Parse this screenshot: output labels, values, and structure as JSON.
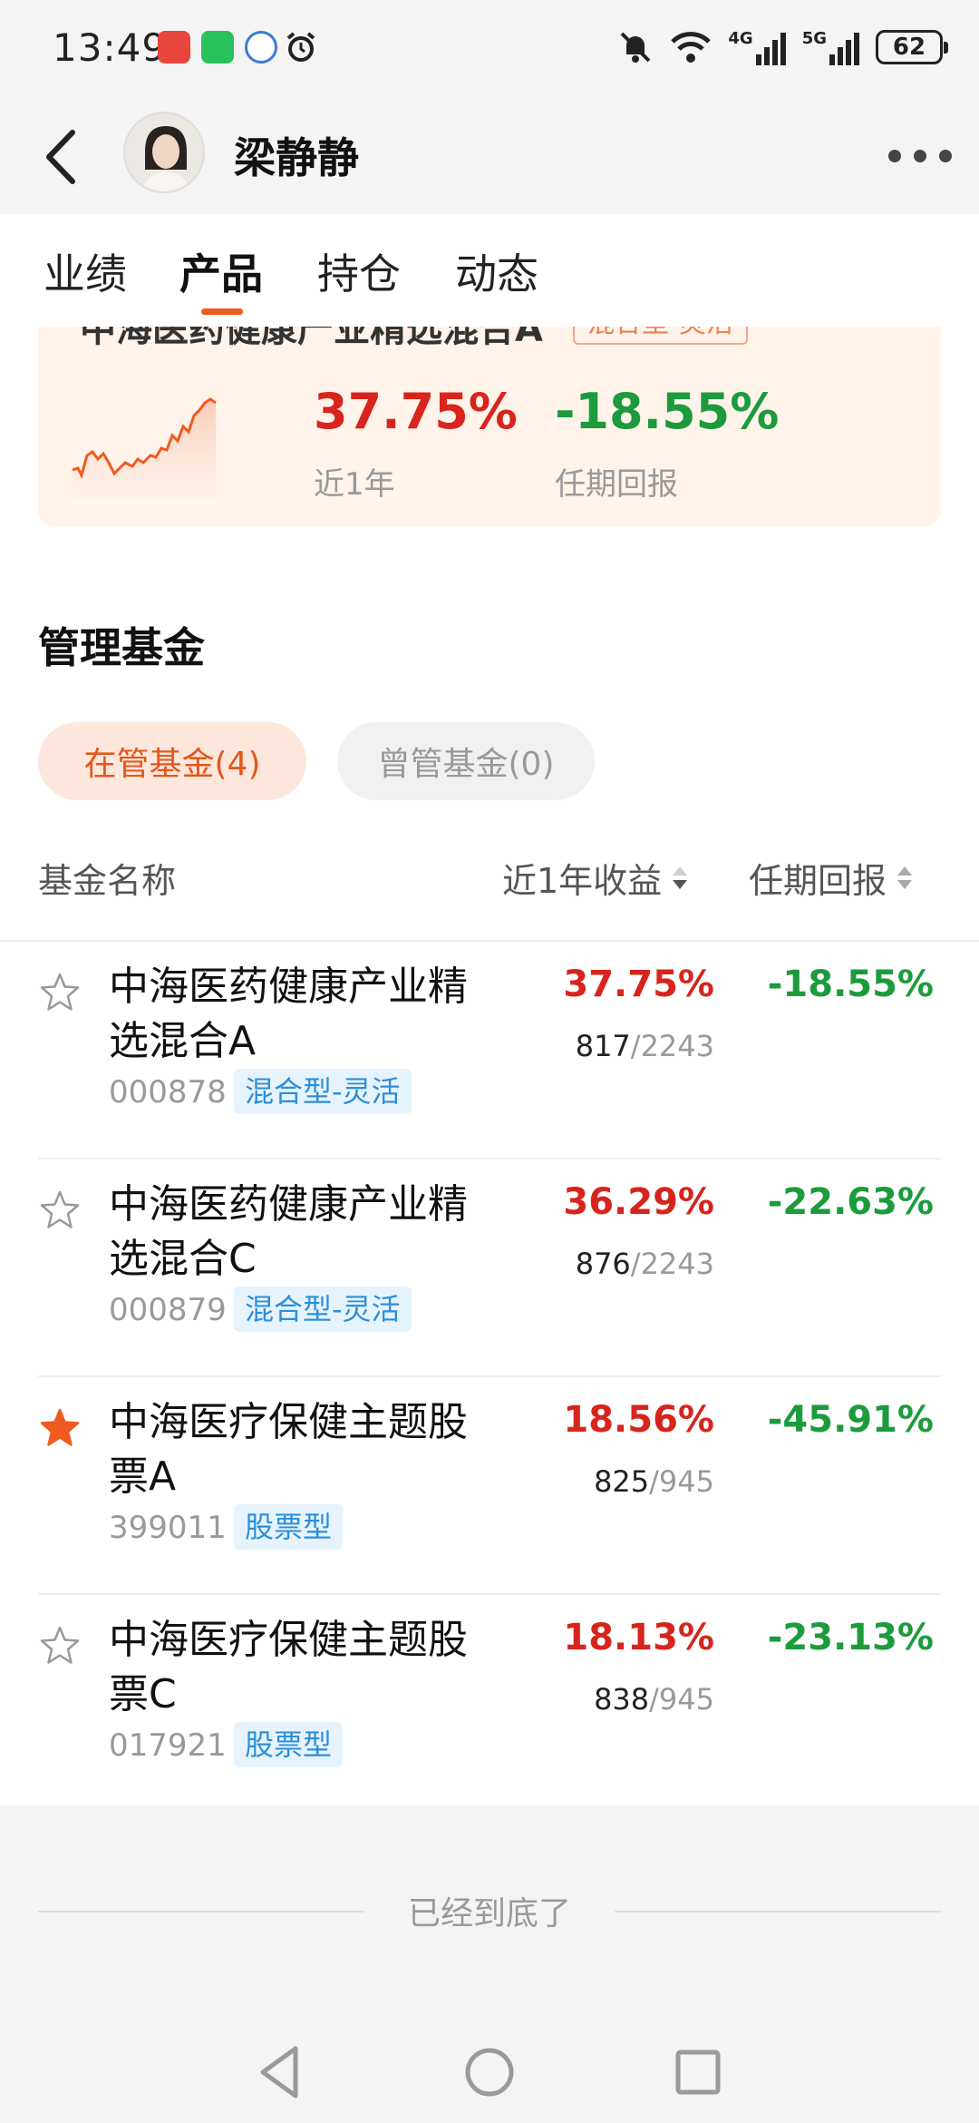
{
  "status_bar": {
    "time": "13:49",
    "battery": "62",
    "network_labels": [
      "4G",
      "5G"
    ]
  },
  "header": {
    "manager_name": "梁静静"
  },
  "tabs": [
    {
      "label": "业绩",
      "active": false
    },
    {
      "label": "产品",
      "active": true
    },
    {
      "label": "持仓",
      "active": false
    },
    {
      "label": "动态",
      "active": false
    }
  ],
  "top_card": {
    "fund_name": "中海医药健康产业精选混合A",
    "tag": "混合型-灵活",
    "ret_1y": "37.75%",
    "ret_1y_label": "近1年",
    "ret_tenure": "-18.55%",
    "ret_tenure_label": "任期回报"
  },
  "section": {
    "title": "管理基金",
    "pill_active": "在管基金(4)",
    "pill_inactive": "曾管基金(0)"
  },
  "columns": {
    "name": "基金名称",
    "ret_1y": "近1年收益",
    "ret_tenure": "任期回报"
  },
  "funds": [
    {
      "name": "中海医药健康产业精选混合A",
      "code": "000878",
      "type": "混合型-灵活",
      "ret_1y": "37.75%",
      "rank": "817",
      "total": "/2243",
      "ret_tenure": "-18.55%",
      "starred": false
    },
    {
      "name": "中海医药健康产业精选混合C",
      "code": "000879",
      "type": "混合型-灵活",
      "ret_1y": "36.29%",
      "rank": "876",
      "total": "/2243",
      "ret_tenure": "-22.63%",
      "starred": false
    },
    {
      "name": "中海医疗保健主题股票A",
      "code": "399011",
      "type": "股票型",
      "ret_1y": "18.56%",
      "rank": "825",
      "total": "/945",
      "ret_tenure": "-45.91%",
      "starred": true
    },
    {
      "name": "中海医疗保健主题股票C",
      "code": "017921",
      "type": "股票型",
      "ret_1y": "18.13%",
      "rank": "838",
      "total": "/945",
      "ret_tenure": "-23.13%",
      "starred": false
    }
  ],
  "footer": {
    "end_text": "已经到底了"
  },
  "colors": {
    "accent": "#ef5a1e",
    "positive": "#d7241c",
    "negative": "#1c9b3c",
    "tag_blue": "#2b8fd8"
  }
}
